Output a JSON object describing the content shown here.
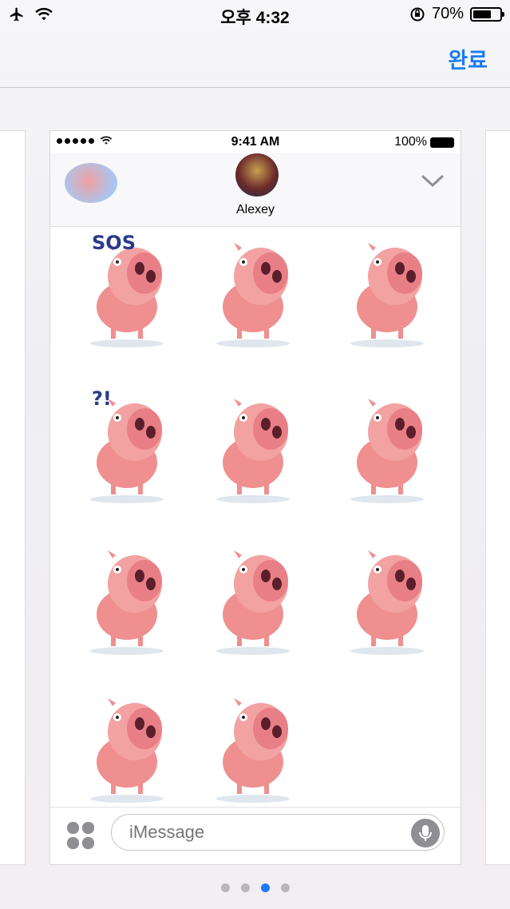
{
  "status_bar": {
    "time": "오후 4:32",
    "battery_text": "70%",
    "battery_level": 0.7
  },
  "toolbar": {
    "done_label": "완료"
  },
  "preview": {
    "status": {
      "time": "9:41 AM",
      "battery_text": "100%"
    },
    "contact": {
      "name": "Alexey"
    },
    "stickers": [
      {
        "name": "sticker-pig-sos",
        "caption": "SOS"
      },
      {
        "name": "sticker-pig-armchair",
        "caption": ""
      },
      {
        "name": "sticker-pig-angel",
        "caption": ""
      },
      {
        "name": "sticker-pig-confused",
        "caption": "?!"
      },
      {
        "name": "sticker-pig-angry",
        "caption": ""
      },
      {
        "name": "sticker-pig-walrus",
        "caption": ""
      },
      {
        "name": "sticker-pig-yoga",
        "caption": ""
      },
      {
        "name": "sticker-pig-rollerskates",
        "caption": ""
      },
      {
        "name": "sticker-pig-pizza",
        "caption": ""
      },
      {
        "name": "sticker-pig-mariachi",
        "caption": ""
      },
      {
        "name": "sticker-pig-medal",
        "caption": ""
      }
    ],
    "input": {
      "placeholder": "iMessage"
    }
  },
  "pager": {
    "count": 4,
    "active_index": 2
  },
  "colors": {
    "accent": "#1a7cf5",
    "pig": "#ef8f8f"
  }
}
